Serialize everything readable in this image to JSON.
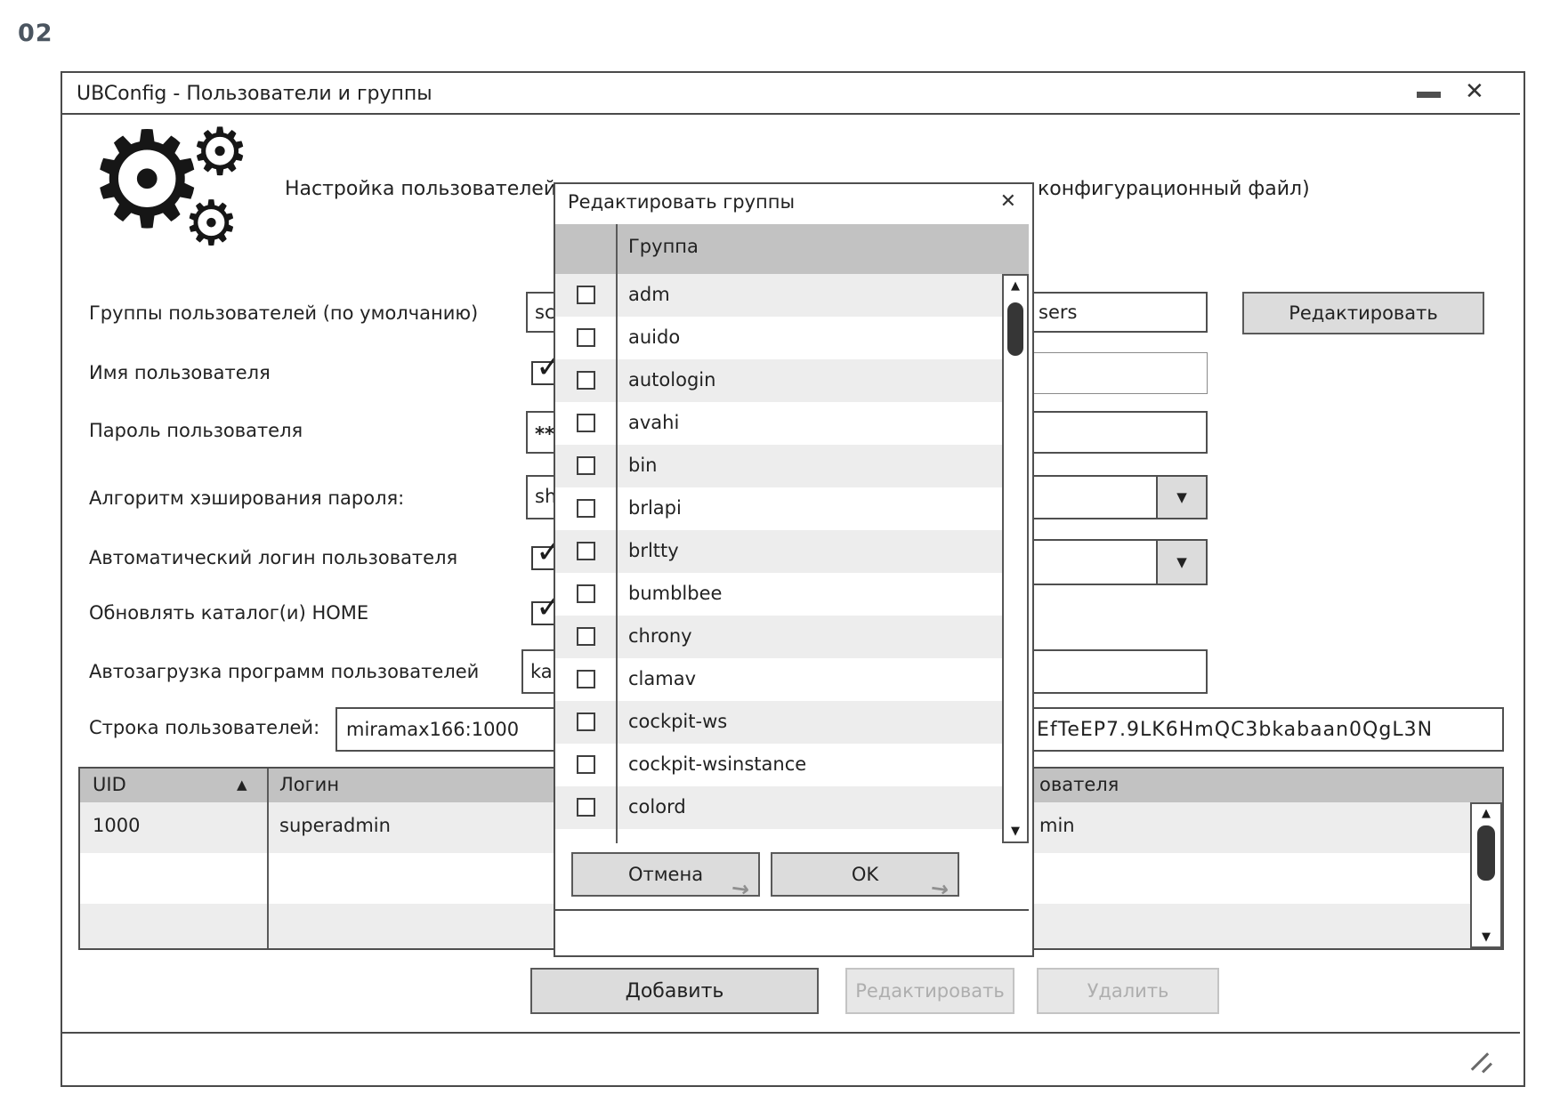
{
  "page": {
    "label": "02"
  },
  "window": {
    "title": "UBConfig - Пользователи и группы"
  },
  "icons": {
    "gear": "⚙",
    "close": "✕",
    "dropdown_arrow": "▼",
    "sort_asc": "▲",
    "scroll_up": "▲",
    "scroll_down": "▼",
    "cursor_arrow": "→"
  },
  "intro": {
    "text_left": "Настройка пользователей",
    "text_right": "конфигурационный файл)"
  },
  "form": {
    "rows": [
      {
        "label": "Группы пользователей (по умолчанию)",
        "value_left": "sc",
        "value_right": "sers",
        "action": "Редактировать"
      },
      {
        "label": "Имя пользователя",
        "checked": true
      },
      {
        "label": "Пароль пользователя",
        "value": "**"
      },
      {
        "label": "Алгоритм хэширования пароля:",
        "value": "sh"
      },
      {
        "label": "Автоматический логин пользователя",
        "checked": true
      },
      {
        "label": "Обновлять каталог(и) HOME",
        "checked": true
      },
      {
        "label": "Автозагрузка программ пользователей",
        "value": "ka"
      },
      {
        "label": "Строка пользователей:",
        "value_left": "miramax166:1000",
        "value_right": "EfTeEP7.9LK6HmQC3bkabaan0QgL3N"
      }
    ]
  },
  "table": {
    "columns": {
      "uid": "UID",
      "login": "Логин",
      "right_fragment": "ователя"
    },
    "rows": [
      {
        "uid": "1000",
        "login": "superadmin",
        "right_fragment": "min"
      }
    ]
  },
  "actions": {
    "add": "Добавить",
    "edit": "Редактировать",
    "delete": "Удалить"
  },
  "dialog": {
    "title": "Редактировать группы",
    "column_header": "Группа",
    "groups": [
      {
        "name": "adm",
        "checked": false
      },
      {
        "name": "auido",
        "checked": false
      },
      {
        "name": "autologin",
        "checked": false
      },
      {
        "name": "avahi",
        "checked": false
      },
      {
        "name": "bin",
        "checked": false
      },
      {
        "name": "brlapi",
        "checked": false
      },
      {
        "name": "brltty",
        "checked": false
      },
      {
        "name": "bumblbee",
        "checked": false
      },
      {
        "name": "chrony",
        "checked": false
      },
      {
        "name": "clamav",
        "checked": false
      },
      {
        "name": "cockpit-ws",
        "checked": false
      },
      {
        "name": "cockpit-wsinstance",
        "checked": false
      },
      {
        "name": "colord",
        "checked": false
      }
    ],
    "buttons": {
      "cancel": "Отмена",
      "ok": "OK"
    }
  }
}
